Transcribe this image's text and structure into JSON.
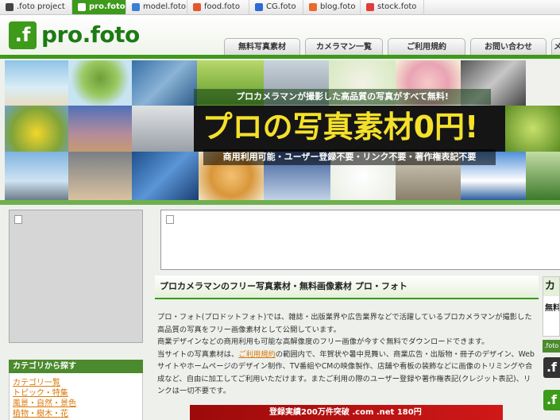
{
  "site_tabs": [
    {
      "label": ".foto project",
      "icon": "foto-project-icon",
      "color": "#444444",
      "active": false
    },
    {
      "label": "pro.foto",
      "icon": "pro-foto-icon",
      "color": "#3d9a1a",
      "active": true
    },
    {
      "label": "model.foto",
      "icon": "model-foto-icon",
      "color": "#3b7fd6",
      "active": false
    },
    {
      "label": "food.foto",
      "icon": "food-foto-icon",
      "color": "#e4572e",
      "active": false
    },
    {
      "label": "CG.foto",
      "icon": "cg-foto-icon",
      "color": "#2e6bd4",
      "active": false
    },
    {
      "label": "blog.foto",
      "icon": "blog-foto-icon",
      "color": "#e86a2b",
      "active": false
    },
    {
      "label": "stock.foto",
      "icon": "stock-foto-icon",
      "color": "#e23b3b",
      "active": false
    }
  ],
  "header": {
    "logo_mark": ".f",
    "logo_text": "pro.foto",
    "nav": [
      "無料写真素材",
      "カメラマン一覧",
      "ご利用規約",
      "お問い合わせ",
      "メ"
    ]
  },
  "banner": {
    "ribbon": "プロカメラマンが撮影した高品質の写真がすべて無料!",
    "title": "プロの写真素材0円!",
    "caption": "商用利用可能・ユーザー登録不要・リンク不要・著作権表記不要"
  },
  "sidebar": {
    "category_heading": "カテゴリから探す",
    "categories": [
      "カテゴリ一覧",
      "トピック・特集",
      "風景・自然・景色",
      "植物・樹木・花"
    ]
  },
  "main": {
    "section_title": "プロカメラマンのフリー写真素材・無料画像素材 プロ・フォト",
    "para1": "プロ・フォト(プロドットフォト)では、雑誌・出版業界や広告業界などで活躍しているプロカメラマンが撮影した高品質の写真をフリー画像素材として公開しています。",
    "para2": "商業デザインなどの商用利用も可能な高解像度のフリー画像が今すぐ無料でダウンロードできます。",
    "para3_pre": "当サイトの写真素材は、",
    "para3_link": "ご利用規約",
    "para3_post": "の範囲内で、年賀状や暑中見舞い、商業広告・出版物・冊子のデザイン、Webサイトやホームページのデザイン制作、TV番組やCMの映像製作、店舗や看板の装飾などに画像のトリミングや合成など、自由に加工してご利用いただけます。またご利用の際のユーザー登録や著作権表記(クレジット表記)、リンクは一切不要です。",
    "ad_text": "登録実績200万件突破   .com .net 180円"
  },
  "right": {
    "heading": "カ",
    "sub": "無料",
    "strip": ".foto",
    "logo1": ".f",
    "logo2": ".f"
  },
  "colors": {
    "brand_green": "#3d9a1a",
    "dark_green": "#4c8a2e",
    "link_orange": "#d97a0a",
    "banner_yellow": "#f5e12a"
  }
}
